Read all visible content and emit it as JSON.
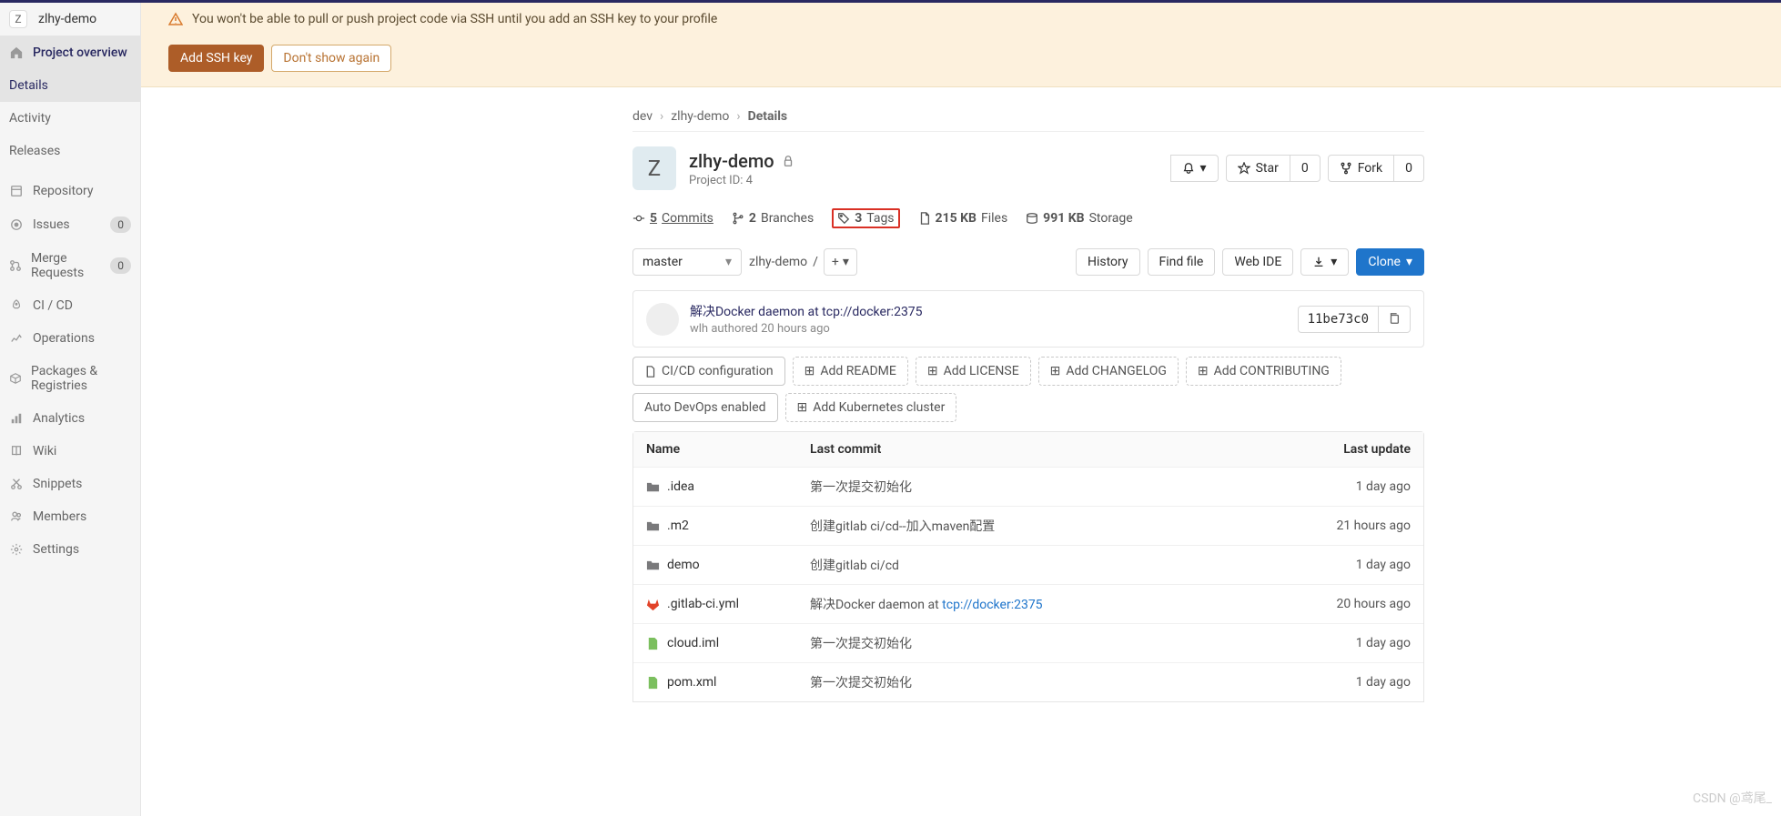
{
  "sidebar": {
    "project_initial": "Z",
    "project_name": "zlhy-demo",
    "overview": "Project overview",
    "sub": {
      "details": "Details",
      "activity": "Activity",
      "releases": "Releases"
    },
    "items": {
      "repository": "Repository",
      "issues": "Issues",
      "issues_count": "0",
      "merge": "Merge Requests",
      "merge_count": "0",
      "cicd": "CI / CD",
      "operations": "Operations",
      "packages": "Packages & Registries",
      "analytics": "Analytics",
      "wiki": "Wiki",
      "snippets": "Snippets",
      "members": "Members",
      "settings": "Settings"
    }
  },
  "alert": {
    "text": "You won't be able to pull or push project code via SSH until you add an SSH key to your profile",
    "add_key": "Add SSH key",
    "dismiss": "Don't show again"
  },
  "breadcrumb": {
    "a": "dev",
    "b": "zlhy-demo",
    "c": "Details"
  },
  "project": {
    "initial": "Z",
    "name": "zlhy-demo",
    "id": "Project ID: 4",
    "star_label": "Star",
    "star_count": "0",
    "fork_label": "Fork",
    "fork_count": "0"
  },
  "stats": {
    "commits_n": "5",
    "commits_l": "Commits",
    "branches_n": "2",
    "branches_l": "Branches",
    "tags_n": "3",
    "tags_l": "Tags",
    "files_n": "215 KB",
    "files_l": "Files",
    "storage_n": "991 KB",
    "storage_l": "Storage"
  },
  "tree": {
    "branch": "master",
    "path": "zlhy-demo",
    "history": "History",
    "find": "Find file",
    "ide": "Web IDE",
    "clone": "Clone"
  },
  "commit": {
    "msg": "解决Docker daemon at tcp://docker:2375",
    "author": "wlh authored",
    "time": "20 hours ago",
    "sha": "11be73c0"
  },
  "quick": {
    "cicd": "CI/CD configuration",
    "readme": "Add README",
    "license": "Add LICENSE",
    "changelog": "Add CHANGELOG",
    "contrib": "Add CONTRIBUTING",
    "autodevops": "Auto DevOps enabled",
    "k8s": "Add Kubernetes cluster"
  },
  "table": {
    "h_name": "Name",
    "h_commit": "Last commit",
    "h_date": "Last update",
    "rows": [
      {
        "type": "folder",
        "name": ".idea",
        "commit": "第一次提交初始化",
        "date": "1 day ago"
      },
      {
        "type": "folder",
        "name": ".m2",
        "commit": "创建gitlab ci/cd--加入maven配置",
        "date": "21 hours ago"
      },
      {
        "type": "folder",
        "name": "demo",
        "commit": "创建gitlab ci/cd",
        "date": "1 day ago"
      },
      {
        "type": "gitlab",
        "name": ".gitlab-ci.yml",
        "commit_prefix": "解决Docker daemon at ",
        "commit_link": "tcp://docker:2375",
        "date": "20 hours ago"
      },
      {
        "type": "file",
        "name": "cloud.iml",
        "commit": "第一次提交初始化",
        "date": "1 day ago"
      },
      {
        "type": "file",
        "name": "pom.xml",
        "commit": "第一次提交初始化",
        "date": "1 day ago"
      }
    ]
  },
  "watermark": "CSDN @鸢尾_"
}
